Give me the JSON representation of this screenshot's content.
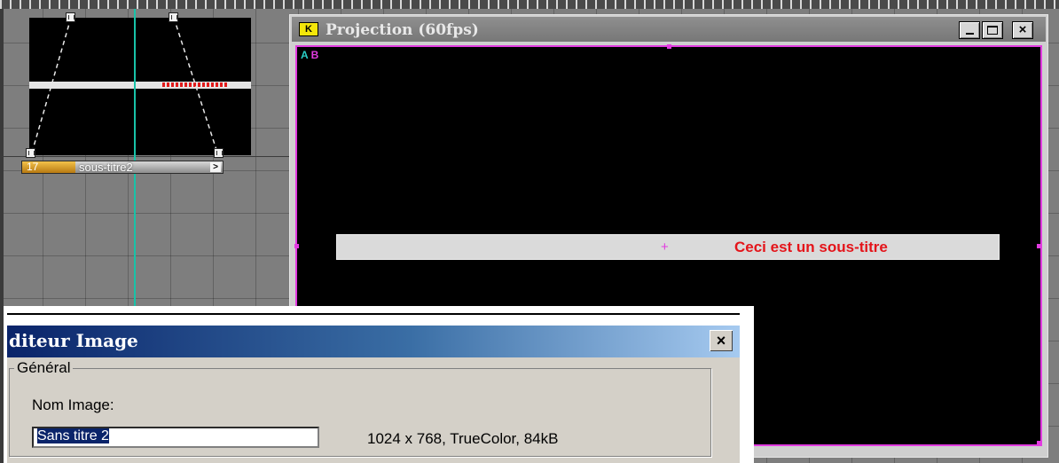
{
  "timeline": {
    "clip": {
      "number": "17",
      "name": "sous-titre2",
      "arrow": ">"
    }
  },
  "projection_window": {
    "title": "Projection (60fps)",
    "icon_glyph": "K",
    "layer_a": "A",
    "layer_b": "B",
    "crosshair": "+",
    "subtitle_text": "Ceci est un sous-titre",
    "close_glyph": "×",
    "colors": {
      "selection": "#e23be0",
      "subtitle": "#e4141a",
      "playhead": "#18c3a8",
      "clip_number_bg": "#f3c24a"
    }
  },
  "editor_dialog": {
    "title": "diteur Image",
    "close_glyph": "×",
    "group_title": "Général",
    "name_label": "Nom Image:",
    "name_value": "Sans titre 2",
    "image_info": "1024 x 768, TrueColor, 84kB"
  },
  "icons": [
    "keyframe-icon",
    "app-icon",
    "minimize-icon",
    "maximize-icon",
    "close-icon"
  ]
}
